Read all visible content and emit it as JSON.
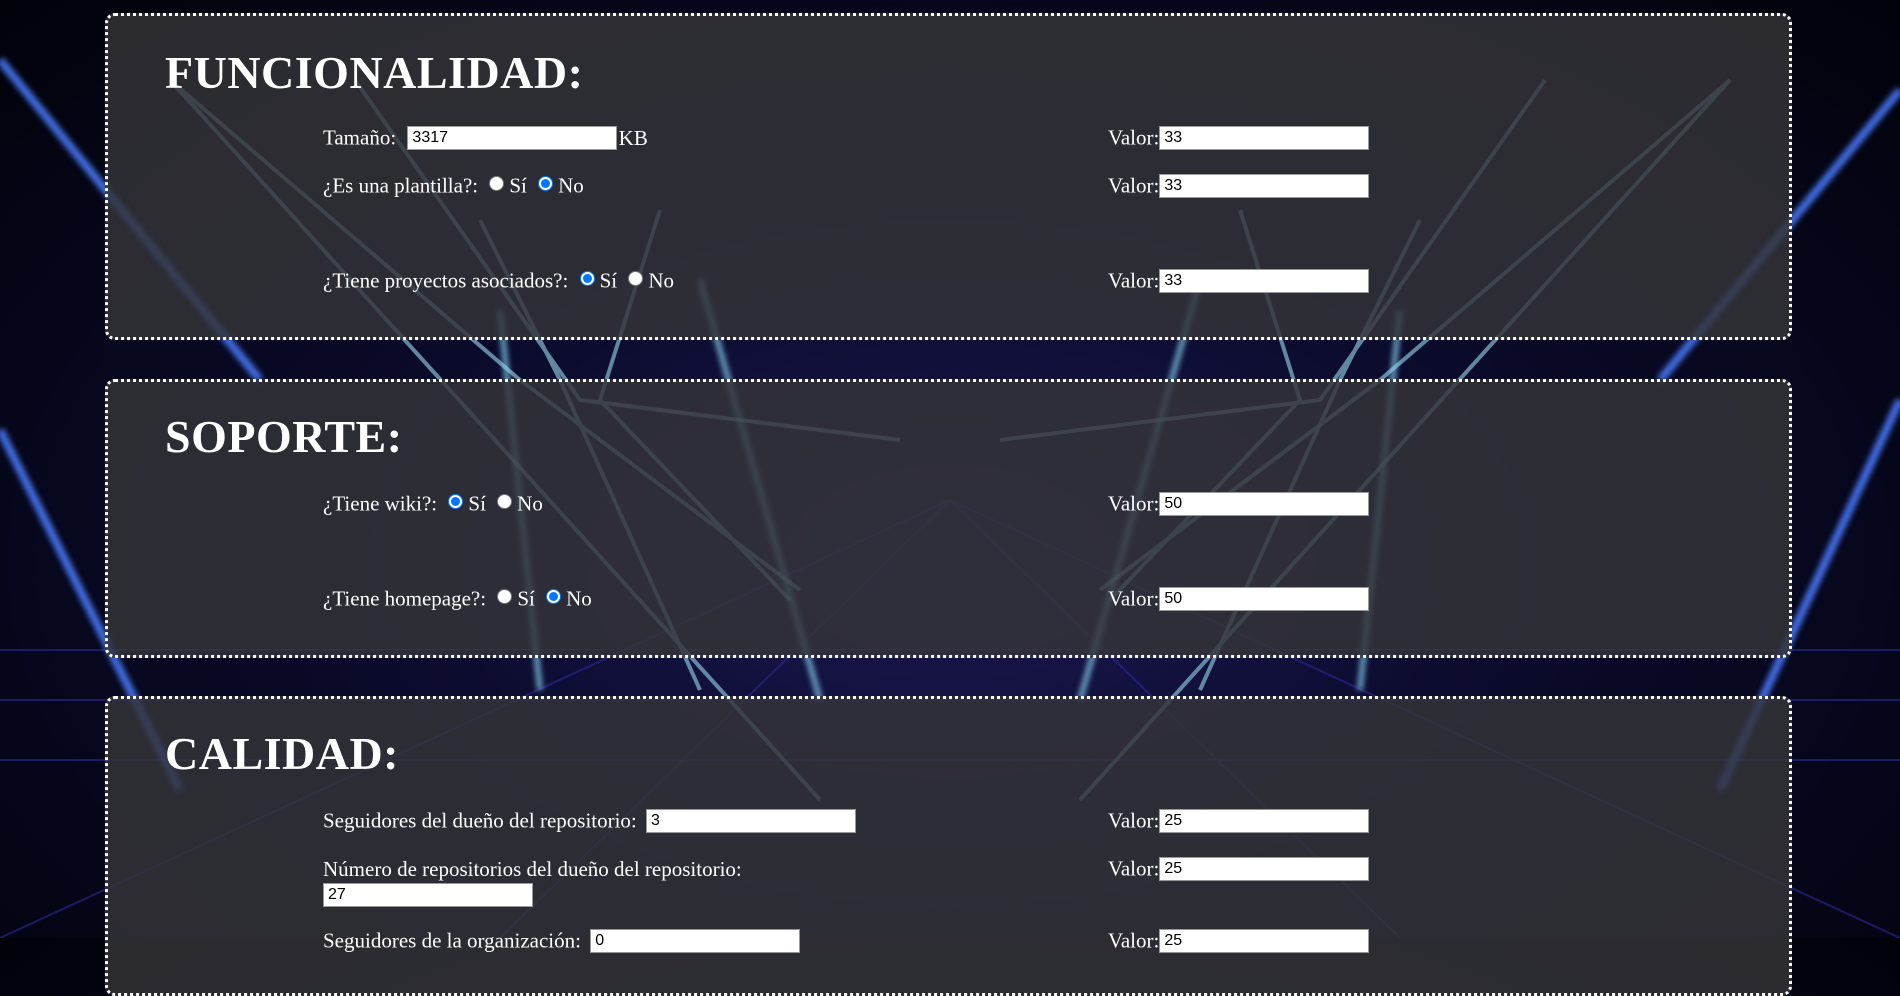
{
  "funcionalidad": {
    "title": "FUNCIONALIDAD:",
    "tamano": {
      "label": "Tamaño:",
      "value": "3317",
      "unit": "KB",
      "valor_label": "Valor:",
      "valor": "33"
    },
    "plantilla": {
      "label": "¿Es una plantilla?:",
      "opt_si": "Sí",
      "opt_no": "No",
      "selected": "No",
      "valor_label": "Valor:",
      "valor": "33"
    },
    "proyectos": {
      "label": "¿Tiene proyectos asociados?:",
      "opt_si": "Sí",
      "opt_no": "No",
      "selected": "Sí",
      "valor_label": "Valor:",
      "valor": "33"
    }
  },
  "soporte": {
    "title": "SOPORTE:",
    "wiki": {
      "label": "¿Tiene wiki?:",
      "opt_si": "Sí",
      "opt_no": "No",
      "selected": "Sí",
      "valor_label": "Valor:",
      "valor": "50"
    },
    "homepage": {
      "label": "¿Tiene homepage?:",
      "opt_si": "Sí",
      "opt_no": "No",
      "selected": "No",
      "valor_label": "Valor:",
      "valor": "50"
    }
  },
  "calidad": {
    "title": "CALIDAD:",
    "seguidores_dueno": {
      "label": "Seguidores del dueño del repositorio:",
      "value": "3",
      "valor_label": "Valor:",
      "valor": "25"
    },
    "repos_dueno": {
      "label": "Número de repositorios del dueño del repositorio:",
      "value": "27",
      "valor_label": "Valor:",
      "valor": "25"
    },
    "seguidores_org": {
      "label": "Seguidores de la organización:",
      "value": "0",
      "valor_label": "Valor:",
      "valor": "25"
    }
  }
}
